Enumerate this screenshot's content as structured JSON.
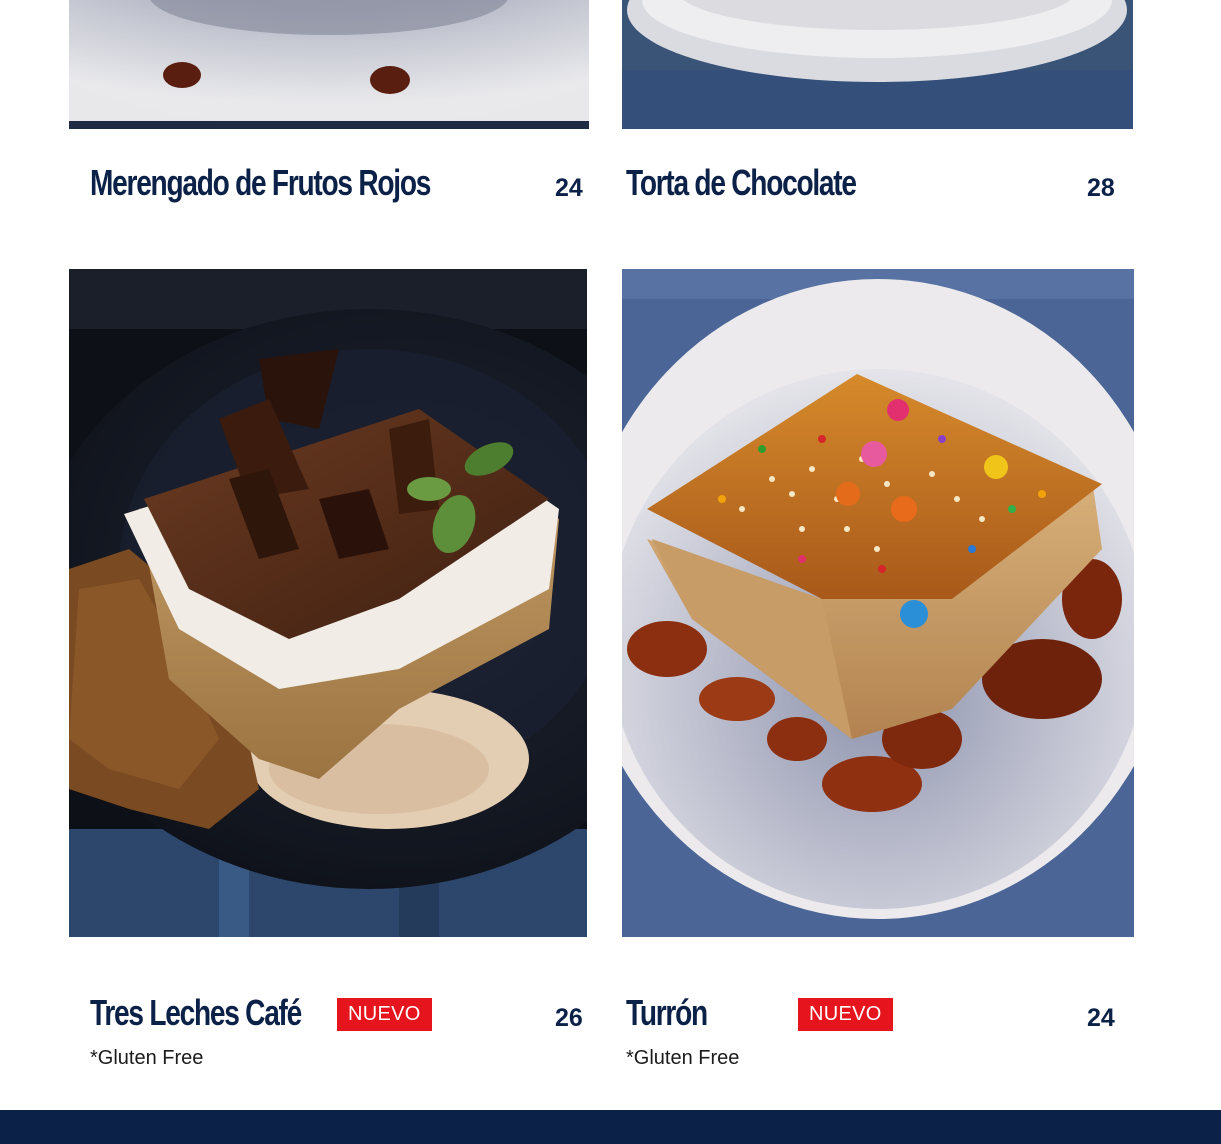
{
  "menu": {
    "items": [
      {
        "name": "Merengado de Frutos Rojos",
        "price": "24"
      },
      {
        "name": "Torta de Chocolate",
        "price": "28"
      },
      {
        "name": "Tres Leches Café",
        "badge": "NUEVO",
        "price": "26",
        "note": "*Gluten Free"
      },
      {
        "name": "Turrón",
        "badge": "NUEVO",
        "price": "24",
        "note": "*Gluten Free"
      }
    ]
  },
  "colors": {
    "title": "#0c2147",
    "badge": "#e5141d",
    "footer": "#0c2147"
  }
}
